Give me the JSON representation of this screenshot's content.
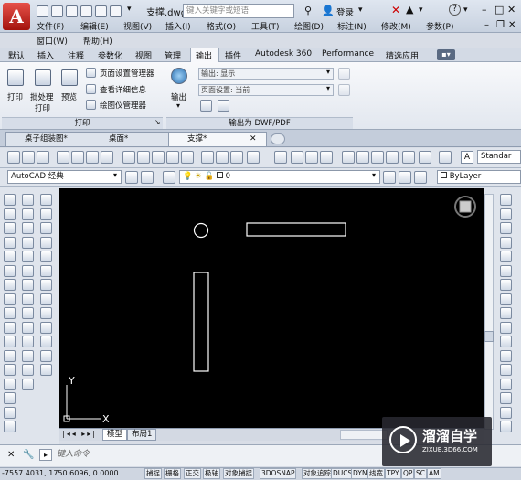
{
  "app": {
    "logo_letter": "A"
  },
  "titlebar": {
    "doc_title": "支撑.dwg",
    "search_placeholder": "键入关键字或短语",
    "login": "登录",
    "help": "?",
    "menu": [
      "文件(F)",
      "编辑(E)",
      "视图(V)",
      "插入(I)",
      "格式(O)",
      "工具(T)",
      "绘图(D)",
      "标注(N)",
      "修改(M)",
      "参数(P)",
      "窗口(W)",
      "帮助(H)"
    ]
  },
  "ribbon": {
    "tabs": [
      "默认",
      "插入",
      "注释",
      "参数化",
      "视图",
      "管理",
      "输出",
      "插件",
      "Autodesk 360",
      "Performance",
      "精选应用"
    ],
    "active_tab": "输出",
    "print_panel": {
      "print": "打印",
      "batch_print": "批处理\n打印",
      "batch_print_l1": "批处理",
      "batch_print_l2": "打印",
      "preview": "预览",
      "page_setup": "页面设置管理器",
      "view_details": "查看详细信息",
      "plotter_manager": "绘图仪管理器",
      "caption": "打印"
    },
    "export_panel": {
      "export_btn": "输出",
      "output_combo": "输出: 显示",
      "page_setup_combo": "页面设置: 当前",
      "caption": "输出为 DWF/PDF"
    }
  },
  "doc_tabs": [
    {
      "label": "桌子组装图*",
      "active": false
    },
    {
      "label": "桌面*",
      "active": false
    },
    {
      "label": "支撑*",
      "active": true
    }
  ],
  "toolbar": {
    "standard_label": "Standar",
    "workspace": "AutoCAD 经典",
    "layer": "0",
    "color": "ByLayer"
  },
  "layout_tabs": [
    "模型",
    "布局1"
  ],
  "command": {
    "placeholder": "键入命令"
  },
  "status": {
    "coords": "-7557.4031, 1750.6096, 0.0000",
    "buttons": [
      "捕捉",
      "栅格",
      "正交",
      "极轴",
      "对象捕捉",
      "3DOSNAP",
      "对象追踪",
      "DUCS",
      "DYN",
      "线宽",
      "TPY",
      "QP",
      "SC",
      "AM"
    ]
  },
  "watermark": {
    "title": "溜溜自学",
    "url": "ZIXUE.3D66.COM"
  },
  "colors": {
    "canvas": "#000000",
    "accent": "#c0201a"
  }
}
